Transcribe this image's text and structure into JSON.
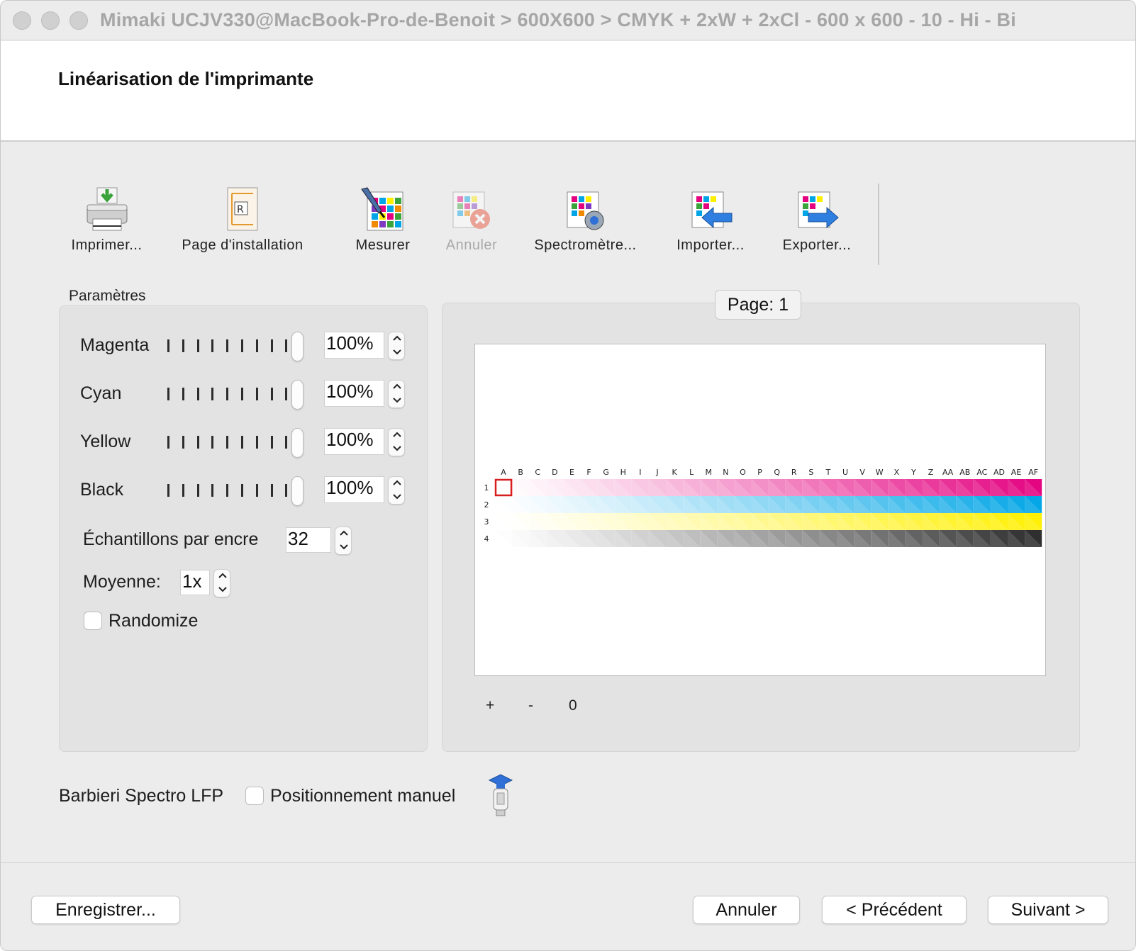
{
  "window": {
    "title": "Mimaki UCJV330@MacBook-Pro-de-Benoit > 600X600 > CMYK + 2xW + 2xCl - 600 x 600 - 10 - Hi - Bi"
  },
  "header": {
    "title": "Linéarisation de l'imprimante"
  },
  "toolbar": {
    "print": "Imprimer...",
    "setup_page": "Page d'installation",
    "measure": "Mesurer",
    "cancel": "Annuler",
    "spectrometer": "Spectromètre...",
    "import": "Importer...",
    "export": "Exporter..."
  },
  "params": {
    "group_label": "Paramètres",
    "inks": [
      {
        "name": "Magenta",
        "value": "100%"
      },
      {
        "name": "Cyan",
        "value": "100%"
      },
      {
        "name": "Yellow",
        "value": "100%"
      },
      {
        "name": "Black",
        "value": "100%"
      }
    ],
    "samples_label": "Échantillons par encre",
    "samples_value": "32",
    "average_label": "Moyenne:",
    "average_value": "1x",
    "randomize_label": "Randomize"
  },
  "preview": {
    "page_label": "Page: 1",
    "zoom_in": "+",
    "zoom_out": "-",
    "zoom_value": "0",
    "columns": [
      "A",
      "B",
      "C",
      "D",
      "E",
      "F",
      "G",
      "H",
      "I",
      "J",
      "K",
      "L",
      "M",
      "N",
      "O",
      "P",
      "Q",
      "R",
      "S",
      "T",
      "U",
      "V",
      "W",
      "X",
      "Y",
      "Z",
      "AA",
      "AB",
      "AC",
      "AD",
      "AE",
      "AF"
    ],
    "rows": [
      "1",
      "2",
      "3",
      "4"
    ],
    "row_colors": [
      "#e4007f",
      "#00a5e6",
      "#fff000",
      "#2b2b2b"
    ]
  },
  "device": {
    "name": "Barbieri Spectro LFP",
    "manual_positioning": "Positionnement manuel"
  },
  "footer": {
    "save": "Enregistrer...",
    "cancel": "Annuler",
    "previous": "< Précédent",
    "next": "Suivant >"
  }
}
